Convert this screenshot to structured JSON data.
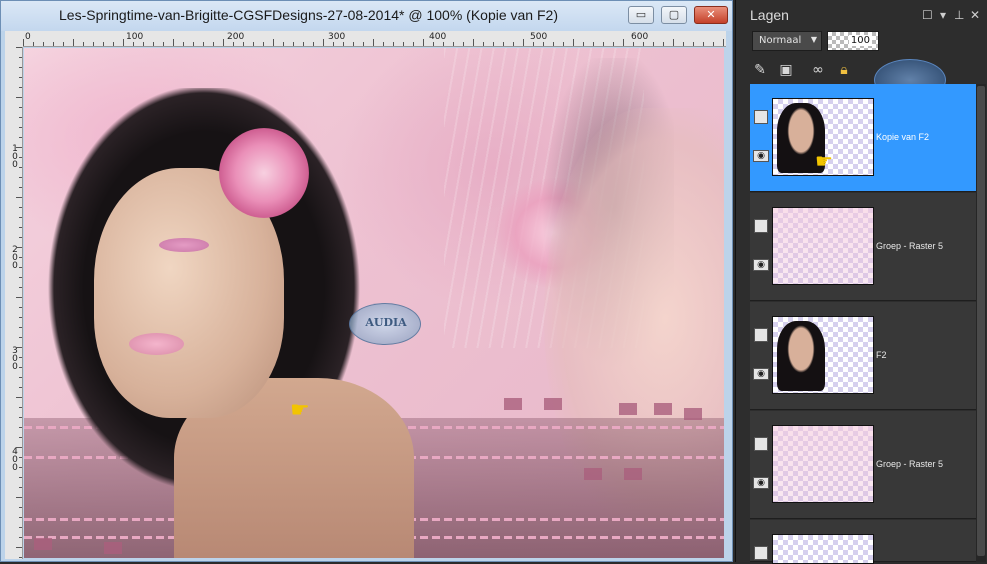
{
  "document": {
    "title": "Les-Springtime-van-Brigitte-CGSFDesigns-27-08-2014* @ 100% (Kopie van F2)",
    "ruler_top": [
      "0",
      "100",
      "200",
      "300",
      "400",
      "500",
      "600"
    ],
    "ruler_left": [
      {
        "label": "1\n0\n0"
      },
      {
        "label": "2\n0\n0"
      },
      {
        "label": "3\n0\n0"
      },
      {
        "label": "4\n0\n0"
      }
    ],
    "watermark_text": "AUDIA"
  },
  "window_controls": {
    "minimize": "▭",
    "maximize": "▢",
    "close": "✕"
  },
  "layers_panel": {
    "title": "Lagen",
    "blend_mode": "Normaal",
    "opacity": "100",
    "layers": [
      {
        "name": "Kopie van F2",
        "selected": true,
        "thumb": "portrait"
      },
      {
        "name": "Groep - Raster 5",
        "selected": false,
        "thumb": "pink"
      },
      {
        "name": "F2",
        "selected": false,
        "thumb": "portrait"
      },
      {
        "name": "Groep - Raster 5",
        "selected": false,
        "thumb": "pink"
      }
    ]
  },
  "colors": {
    "selection": "#3399ff",
    "panel_bg": "#2d2d2d",
    "titlebar": "#c3d7ee"
  }
}
